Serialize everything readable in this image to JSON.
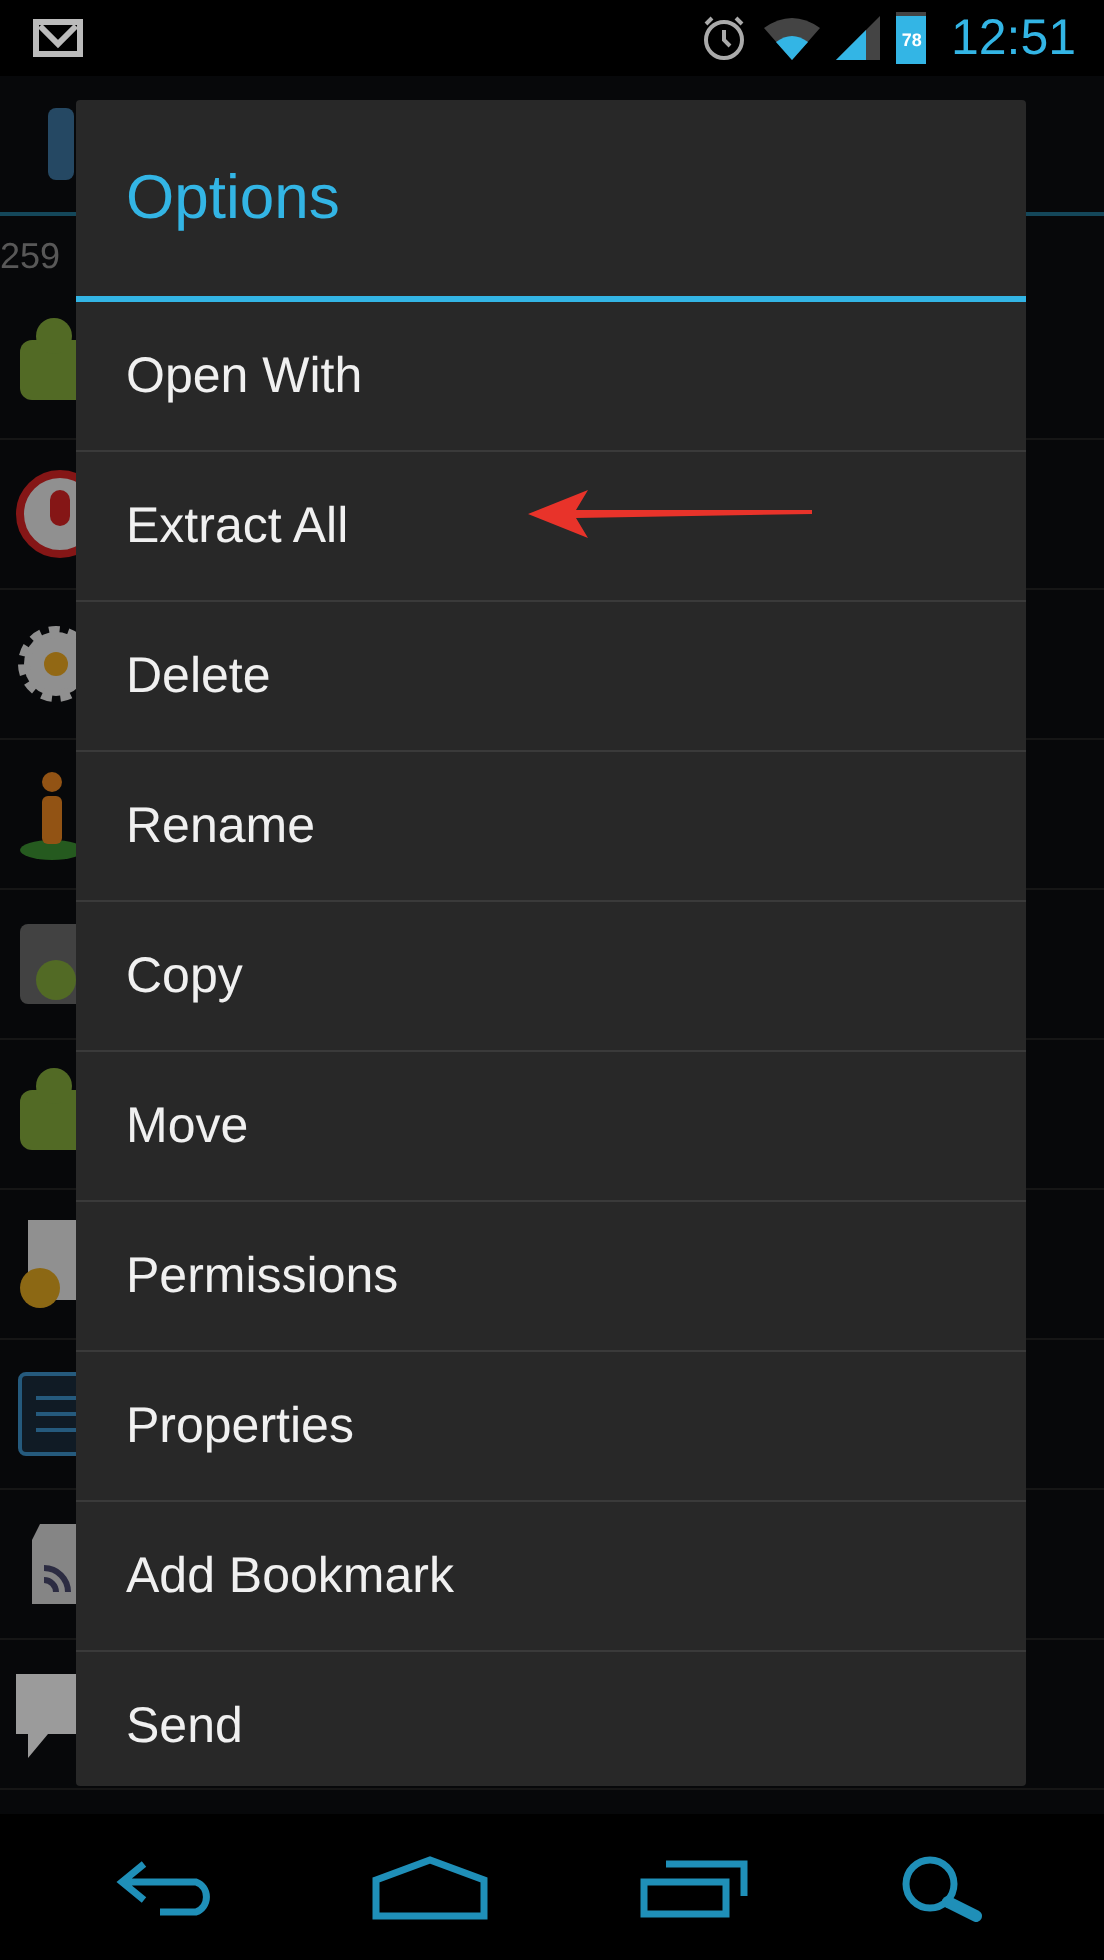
{
  "status_bar": {
    "battery": "78",
    "time": "12:51"
  },
  "background_list": {
    "count": "259"
  },
  "dialog": {
    "title": "Options",
    "items": [
      {
        "label": "Open With"
      },
      {
        "label": "Extract All"
      },
      {
        "label": "Delete"
      },
      {
        "label": "Rename"
      },
      {
        "label": "Copy"
      },
      {
        "label": "Move"
      },
      {
        "label": "Permissions"
      },
      {
        "label": "Properties"
      },
      {
        "label": "Add Bookmark"
      },
      {
        "label": "Send"
      }
    ]
  }
}
